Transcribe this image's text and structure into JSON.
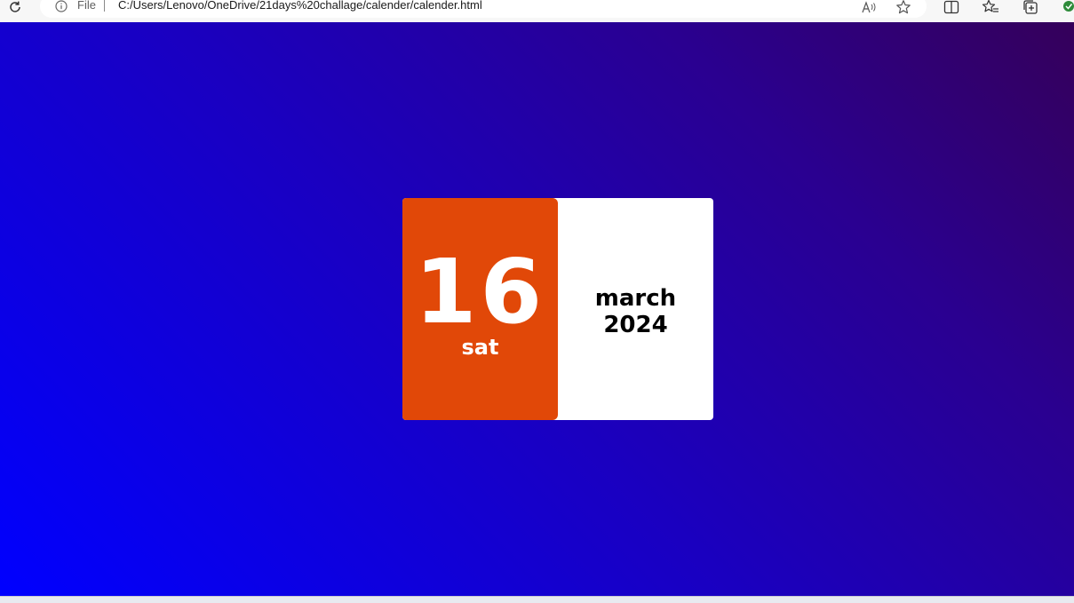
{
  "browser": {
    "address_label": "File",
    "url": "C:/Users/Lenovo/OneDrive/21days%20challage/calender/calender.html",
    "icons": [
      "reload-icon",
      "info-icon",
      "read-aloud-icon",
      "favorite-star-icon",
      "split-screen-icon",
      "favorites-icon",
      "collections-icon",
      "extension-icon"
    ]
  },
  "calendar": {
    "day": "16",
    "weekday": "sat",
    "month": "march",
    "year": "2024",
    "accent_color": "#e14808",
    "card_color": "#ffffff"
  },
  "page": {
    "gradient_colors": [
      "#0000ff",
      "#35005a"
    ]
  }
}
